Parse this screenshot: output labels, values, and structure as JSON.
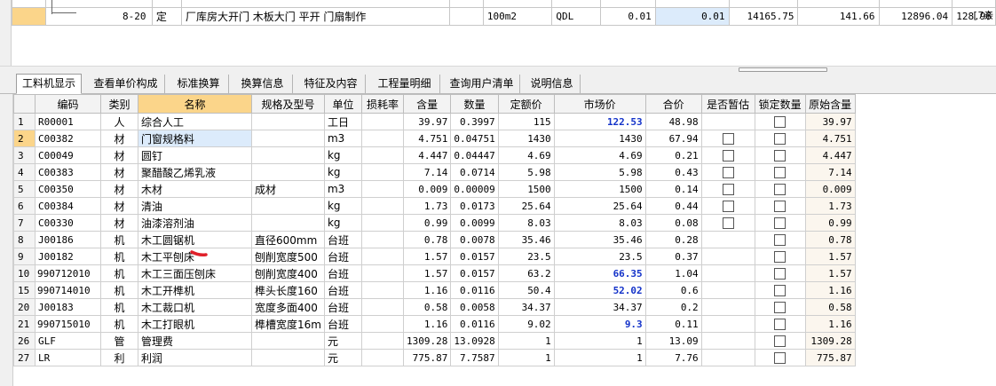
{
  "top_grid": {
    "row": {
      "code": "8-20",
      "type": "定",
      "name": "厂库房大开门 木板大门 平开 门扇制作",
      "unit": "100m2",
      "source": "QDL",
      "qty_expr": "0.01",
      "qty": "0.01",
      "unit_price": "14165.75",
      "total": "141.66",
      "labor_unit": "12896.04",
      "labor_total": "128.96",
      "trailing": "[7亲"
    }
  },
  "tabs": [
    "工料机显示",
    "查看单价构成",
    "标准换算",
    "换算信息",
    "特征及内容",
    "工程量明细",
    "查询用户清单",
    "说明信息"
  ],
  "columns": {
    "code": "编码",
    "category": "类别",
    "name": "名称",
    "spec": "规格及型号",
    "unit": "单位",
    "loss": "损耗率",
    "content": "含量",
    "qty": "数量",
    "quota_price": "定额价",
    "market_price": "市场价",
    "total": "合价",
    "provisional": "是否暂估",
    "lock_qty": "锁定数量",
    "orig_content": "原始含量"
  },
  "rows": [
    {
      "idx": "1",
      "expand": "",
      "code": "R00001",
      "category": "人",
      "name": "综合人工",
      "spec": "",
      "unit": "工日",
      "loss": "",
      "content": "39.97",
      "qty": "0.3997",
      "quota_price": "115",
      "market_price": "122.53",
      "market_bold": true,
      "total": "48.98",
      "prov_cb": false,
      "lock_cb": true,
      "orig": "39.97"
    },
    {
      "idx": "2",
      "expand": "",
      "code": "C00382",
      "category": "材",
      "name": "门窗规格料",
      "spec": "",
      "unit": "m3",
      "loss": "",
      "content": "4.751",
      "qty": "0.04751",
      "quota_price": "1430",
      "market_price": "1430",
      "market_bold": false,
      "total": "67.94",
      "prov_cb": true,
      "lock_cb": true,
      "orig": "4.751"
    },
    {
      "idx": "3",
      "expand": "",
      "code": "C00049",
      "category": "材",
      "name": "圆钉",
      "spec": "",
      "unit": "kg",
      "loss": "",
      "content": "4.447",
      "qty": "0.04447",
      "quota_price": "4.69",
      "market_price": "4.69",
      "market_bold": false,
      "total": "0.21",
      "prov_cb": true,
      "lock_cb": true,
      "orig": "4.447"
    },
    {
      "idx": "4",
      "expand": "",
      "code": "C00383",
      "category": "材",
      "name": "聚醋酸乙烯乳液",
      "spec": "",
      "unit": "kg",
      "loss": "",
      "content": "7.14",
      "qty": "0.0714",
      "quota_price": "5.98",
      "market_price": "5.98",
      "market_bold": false,
      "total": "0.43",
      "prov_cb": true,
      "lock_cb": true,
      "orig": "7.14"
    },
    {
      "idx": "5",
      "expand": "",
      "code": "C00350",
      "category": "材",
      "name": "木材",
      "spec": "成材",
      "unit": "m3",
      "loss": "",
      "content": "0.009",
      "qty": "0.00009",
      "quota_price": "1500",
      "market_price": "1500",
      "market_bold": false,
      "total": "0.14",
      "prov_cb": true,
      "lock_cb": true,
      "orig": "0.009"
    },
    {
      "idx": "6",
      "expand": "",
      "code": "C00384",
      "category": "材",
      "name": "清油",
      "spec": "",
      "unit": "kg",
      "loss": "",
      "content": "1.73",
      "qty": "0.0173",
      "quota_price": "25.64",
      "market_price": "25.64",
      "market_bold": false,
      "total": "0.44",
      "prov_cb": true,
      "lock_cb": true,
      "orig": "1.73"
    },
    {
      "idx": "7",
      "expand": "",
      "code": "C00330",
      "category": "材",
      "name": "油漆溶剂油",
      "spec": "",
      "unit": "kg",
      "loss": "",
      "content": "0.99",
      "qty": "0.0099",
      "quota_price": "8.03",
      "market_price": "8.03",
      "market_bold": false,
      "total": "0.08",
      "prov_cb": true,
      "lock_cb": true,
      "orig": "0.99"
    },
    {
      "idx": "8",
      "expand": "",
      "code": "J00186",
      "category": "机",
      "name": "木工圆锯机",
      "spec": "直径600mm",
      "unit": "台班",
      "loss": "",
      "content": "0.78",
      "qty": "0.0078",
      "quota_price": "35.46",
      "market_price": "35.46",
      "market_bold": false,
      "total": "0.28",
      "prov_cb": false,
      "lock_cb": true,
      "orig": "0.78"
    },
    {
      "idx": "9",
      "expand": "",
      "code": "J00182",
      "category": "机",
      "name": "木工平刨床",
      "spec": "刨削宽度500",
      "unit": "台班",
      "loss": "",
      "content": "1.57",
      "qty": "0.0157",
      "quota_price": "23.5",
      "market_price": "23.5",
      "market_bold": false,
      "total": "0.37",
      "prov_cb": false,
      "lock_cb": true,
      "orig": "1.57"
    },
    {
      "idx": "10",
      "expand": "+",
      "code": "990712010",
      "category": "机",
      "name": "木工三面压刨床",
      "spec": "刨削宽度400",
      "unit": "台班",
      "loss": "",
      "content": "1.57",
      "qty": "0.0157",
      "quota_price": "63.2",
      "market_price": "66.35",
      "market_bold": true,
      "total": "1.04",
      "prov_cb": false,
      "lock_cb": true,
      "orig": "1.57"
    },
    {
      "idx": "15",
      "expand": "+",
      "code": "990714010",
      "category": "机",
      "name": "木工开榫机",
      "spec": "榫头长度160",
      "unit": "台班",
      "loss": "",
      "content": "1.16",
      "qty": "0.0116",
      "quota_price": "50.4",
      "market_price": "52.02",
      "market_bold": true,
      "total": "0.6",
      "prov_cb": false,
      "lock_cb": true,
      "orig": "1.16"
    },
    {
      "idx": "20",
      "expand": "",
      "code": "J00183",
      "category": "机",
      "name": "木工裁口机",
      "spec": "宽度多面400",
      "unit": "台班",
      "loss": "",
      "content": "0.58",
      "qty": "0.0058",
      "quota_price": "34.37",
      "market_price": "34.37",
      "market_bold": false,
      "total": "0.2",
      "prov_cb": false,
      "lock_cb": true,
      "orig": "0.58"
    },
    {
      "idx": "21",
      "expand": "+",
      "code": "990715010",
      "category": "机",
      "name": "木工打眼机",
      "spec": "榫槽宽度16m",
      "unit": "台班",
      "loss": "",
      "content": "1.16",
      "qty": "0.0116",
      "quota_price": "9.02",
      "market_price": "9.3",
      "market_bold": true,
      "total": "0.11",
      "prov_cb": false,
      "lock_cb": true,
      "orig": "1.16"
    },
    {
      "idx": "26",
      "expand": "",
      "code": "GLF",
      "category": "管",
      "name": "管理费",
      "spec": "",
      "unit": "元",
      "loss": "",
      "content": "1309.28",
      "qty": "13.0928",
      "quota_price": "1",
      "market_price": "1",
      "market_bold": false,
      "total": "13.09",
      "prov_cb": false,
      "lock_cb": true,
      "orig": "1309.28"
    },
    {
      "idx": "27",
      "expand": "",
      "code": "LR",
      "category": "利",
      "name": "利润",
      "spec": "",
      "unit": "元",
      "loss": "",
      "content": "775.87",
      "qty": "7.7587",
      "quota_price": "1",
      "market_price": "1",
      "market_bold": false,
      "total": "7.76",
      "prov_cb": false,
      "lock_cb": true,
      "orig": "775.87"
    }
  ],
  "colors": {
    "selection": "#fbd58a",
    "highlight_blue": "#dcebfb",
    "price_blue": "#1433c9",
    "annotation_red": "#e0202a"
  }
}
